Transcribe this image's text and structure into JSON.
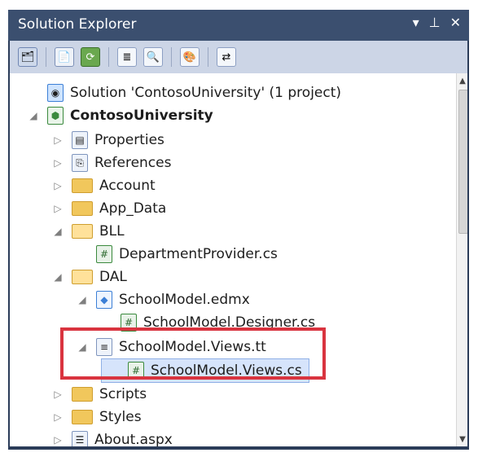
{
  "window": {
    "title": "Solution Explorer",
    "controls": [
      "▾",
      "⊥",
      "✕"
    ]
  },
  "toolbar": {
    "icons": [
      "properties-icon",
      "show-all-files-icon",
      "refresh-icon",
      "view-code-icon",
      "view-designer-icon",
      "class-diagram-icon",
      "copy-website-icon"
    ]
  },
  "tree": {
    "items": [
      {
        "label": "Solution 'ContosoUniversity' (1 project)",
        "arrow": "",
        "icon": "solution-icon",
        "bold": false
      },
      {
        "label": "ContosoUniversity",
        "arrow": "◢",
        "icon": "project-icon",
        "bold": true
      },
      {
        "label": "Properties",
        "arrow": "▷",
        "icon": "properties-icon",
        "bold": false
      },
      {
        "label": "References",
        "arrow": "▷",
        "icon": "references-icon",
        "bold": false
      },
      {
        "label": "Account",
        "arrow": "▷",
        "icon": "folder-icon",
        "bold": false
      },
      {
        "label": "App_Data",
        "arrow": "▷",
        "icon": "folder-icon",
        "bold": false
      },
      {
        "label": "BLL",
        "arrow": "◢",
        "icon": "folder-open-icon",
        "bold": false
      },
      {
        "label": "DepartmentProvider.cs",
        "arrow": "",
        "icon": "cs-file-icon",
        "bold": false
      },
      {
        "label": "DAL",
        "arrow": "◢",
        "icon": "folder-open-icon",
        "bold": false
      },
      {
        "label": "SchoolModel.edmx",
        "arrow": "◢",
        "icon": "edmx-file-icon",
        "bold": false
      },
      {
        "label": "SchoolModel.Designer.cs",
        "arrow": "",
        "icon": "cs-file-icon",
        "bold": false
      },
      {
        "label": "SchoolModel.Views.tt",
        "arrow": "◢",
        "icon": "tt-file-icon",
        "bold": false
      },
      {
        "label": "SchoolModel.Views.cs",
        "arrow": "",
        "icon": "cs-file-icon",
        "bold": false
      },
      {
        "label": "Scripts",
        "arrow": "▷",
        "icon": "folder-icon",
        "bold": false
      },
      {
        "label": "Styles",
        "arrow": "▷",
        "icon": "folder-icon",
        "bold": false
      },
      {
        "label": "About.aspx",
        "arrow": "▷",
        "icon": "aspx-file-icon",
        "bold": false
      }
    ]
  },
  "colors": {
    "highlight": "#d9343f",
    "selected": "#d6e4fb"
  }
}
